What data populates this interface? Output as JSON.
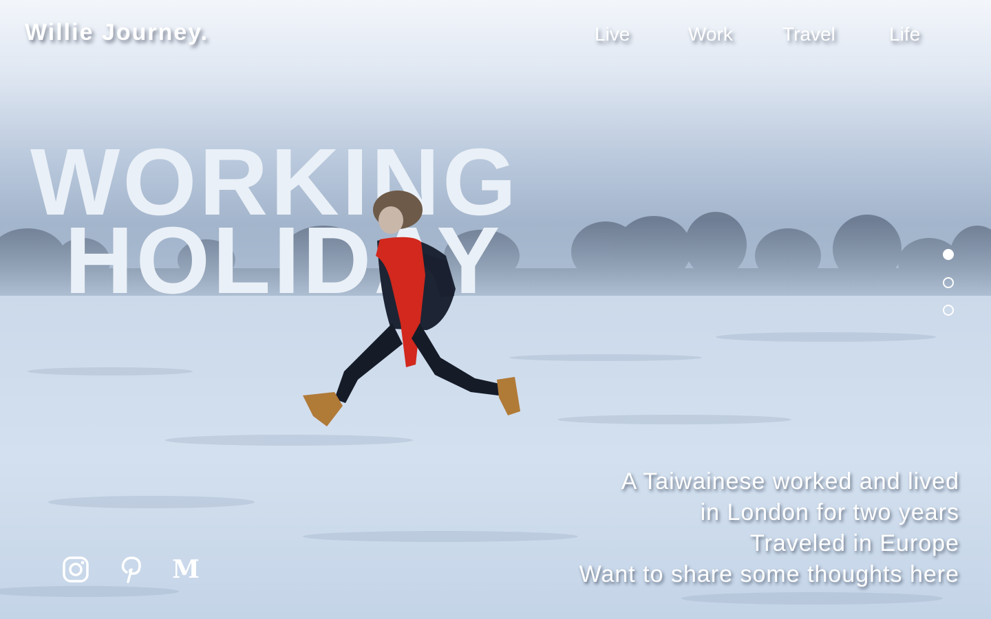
{
  "brand": {
    "logo": "Willie Journey."
  },
  "nav": {
    "items": [
      "Live",
      "Work",
      "Travel",
      "Life"
    ]
  },
  "hero": {
    "line1": "WORKING",
    "line2": "HOLIDAY"
  },
  "tagline": {
    "lines": [
      "A Taiwainese worked and lived",
      "in London for two years",
      "Traveled in Europe",
      "Want to share some thoughts here"
    ]
  },
  "pagination": {
    "count": 3,
    "active": 1
  },
  "socials": {
    "icons": [
      "instagram-icon",
      "pinterest-icon",
      "medium-icon"
    ],
    "medium_glyph": "M"
  },
  "colors": {
    "text": "#ffffff",
    "headline": "#eaf0f7",
    "scarf": "#d2281d"
  }
}
